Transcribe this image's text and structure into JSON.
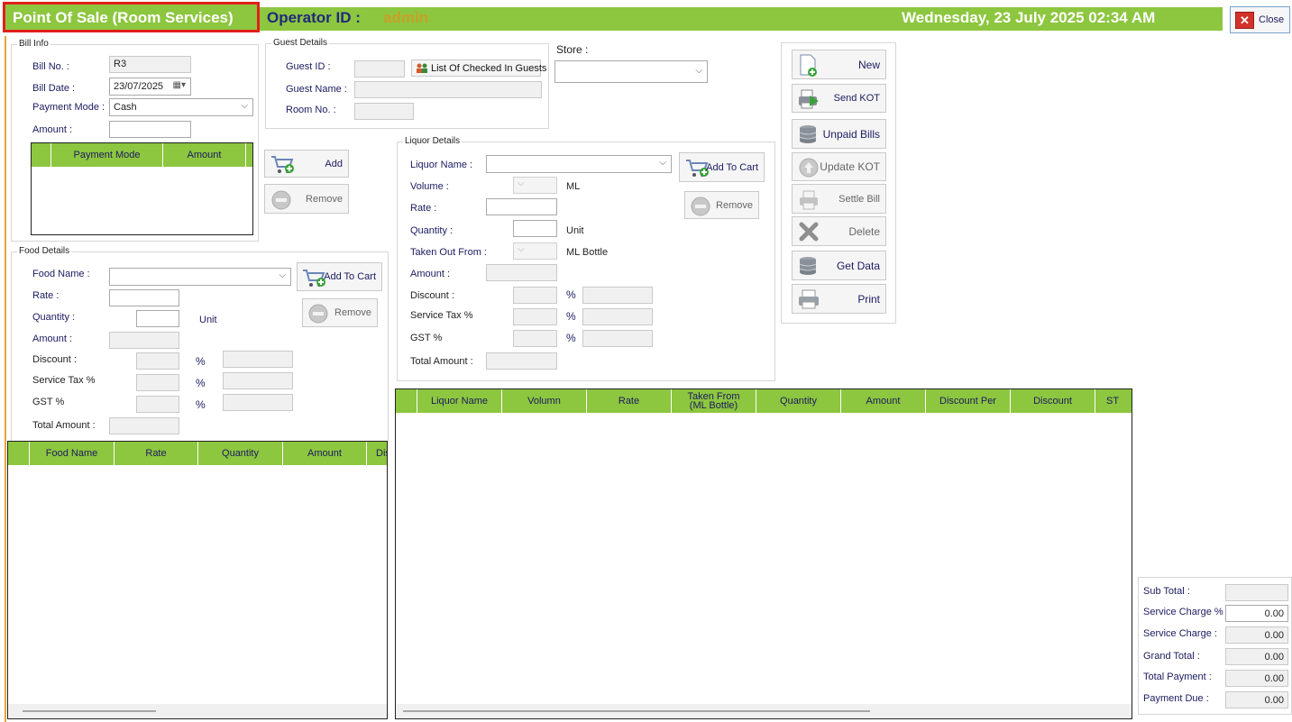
{
  "header": {
    "title": "Point Of Sale (Room Services)",
    "operator_label": "Operator ID :",
    "operator_value": "admin",
    "datetime": "Wednesday, 23 July 2025 02:34 AM",
    "close_label": "Close"
  },
  "bill_info": {
    "title": "Bill Info",
    "bill_no_label": "Bill No. :",
    "bill_no_value": "R3",
    "bill_date_label": "Bill Date :",
    "bill_date_value": "23/07/2025",
    "payment_mode_label": "Payment Mode :",
    "payment_mode_value": "Cash",
    "amount_label": "Amount :",
    "grid_cols": [
      "Payment Mode",
      "Amount"
    ],
    "add_label": "Add",
    "remove_label": "Remove"
  },
  "guest": {
    "title": "Guest Details",
    "guest_id_label": "Guest ID :",
    "list_button": "List Of Checked In Guests",
    "guest_name_label": "Guest Name :",
    "room_no_label": "Room No. :"
  },
  "store": {
    "label": "Store :"
  },
  "liquor": {
    "title": "Liquor Details",
    "name_label": "Liquor Name :",
    "volume_label": "Volume :",
    "volume_unit": "ML",
    "rate_label": "Rate :",
    "quantity_label": "Quantity :",
    "quantity_unit": "Unit",
    "taken_label": "Taken Out From :",
    "taken_unit": "ML Bottle",
    "amount_label": "Amount :",
    "discount_label": "Discount :",
    "service_tax_label": "Service Tax %",
    "gst_label": "GST %",
    "total_label": "Total Amount :",
    "pct": "%",
    "add_to_cart": "Add To Cart",
    "remove": "Remove"
  },
  "food": {
    "title": "Food Details",
    "name_label": "Food Name :",
    "rate_label": "Rate :",
    "quantity_label": "Quantity :",
    "quantity_unit": "Unit",
    "amount_label": "Amount :",
    "discount_label": "Discount :",
    "service_tax_label": "Service Tax %",
    "gst_label": "GST %",
    "total_label": "Total Amount :",
    "pct": "%",
    "add_to_cart": "Add To Cart",
    "remove": "Remove"
  },
  "actions": {
    "new": "New",
    "send_kot": "Send KOT",
    "unpaid_bills": "Unpaid Bills",
    "update_kot": "Update KOT",
    "settle_bill": "Settle Bill",
    "delete": "Delete",
    "get_data": "Get Data",
    "print": "Print"
  },
  "food_grid": {
    "cols": [
      "Food Name",
      "Rate",
      "Quantity",
      "Amount",
      "Dis"
    ]
  },
  "liquor_grid": {
    "cols": [
      "Liquor Name",
      "Volumn",
      "Rate",
      "Taken From\n(ML Bottle)",
      "Quantity",
      "Amount",
      "Discount Per",
      "Discount",
      "ST"
    ]
  },
  "summary": {
    "sub_total_label": "Sub Total :",
    "sub_total_value": "",
    "service_charge_pct_label": "Service Charge % :",
    "service_charge_pct_value": "0.00",
    "service_charge_label": "Service Charge :",
    "service_charge_value": "0.00",
    "grand_total_label": "Grand Total :",
    "grand_total_value": "0.00",
    "total_payment_label": "Total Payment :",
    "total_payment_value": "0.00",
    "payment_due_label": "Payment Due :",
    "payment_due_value": "0.00"
  },
  "colors": {
    "accent": "#8dc63f",
    "title_border": "#e0201b",
    "operator_value": "#c8a028"
  }
}
